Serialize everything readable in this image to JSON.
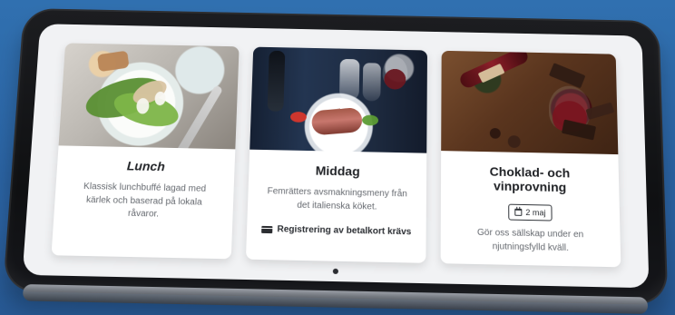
{
  "cards": [
    {
      "title": "Lunch",
      "description": "Klassisk lunchbuffé lagad med kärlek och baserad på lokala råvaror."
    },
    {
      "title": "Middag",
      "description": "Femrätters avsmakningsmeny från det italienska köket.",
      "requirement": "Registrering av betalkort krävs",
      "requirement_icon": "credit-card-icon"
    },
    {
      "title": "Choklad- och vinprovning",
      "date_badge": "2 maj",
      "date_icon": "calendar-icon",
      "description": "Gör oss sällskap under en njutningsfylld kväll."
    }
  ]
}
